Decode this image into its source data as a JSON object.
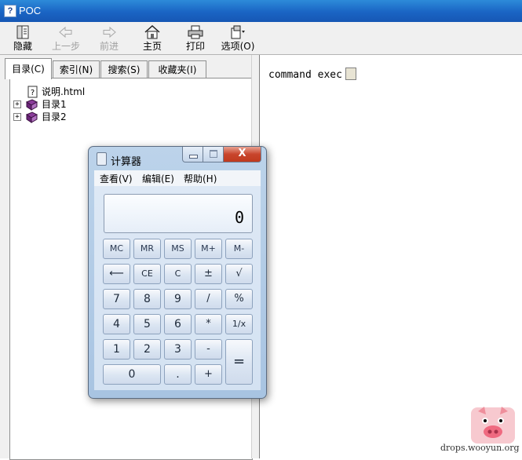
{
  "help_window": {
    "title": "POC",
    "title_icon": "?",
    "toolbar": [
      {
        "label": "隐藏",
        "icon": "hide-icon",
        "enabled": true
      },
      {
        "label": "上一步",
        "icon": "back-arrow-icon",
        "enabled": false
      },
      {
        "label": "前进",
        "icon": "forward-arrow-icon",
        "enabled": false
      },
      {
        "label": "主页",
        "icon": "home-icon",
        "enabled": true
      },
      {
        "label": "打印",
        "icon": "printer-icon",
        "enabled": true
      },
      {
        "label": "选项(O)",
        "icon": "options-icon",
        "enabled": true
      }
    ],
    "tabs": [
      {
        "label": "目录(C)",
        "active": true
      },
      {
        "label": "索引(N)",
        "active": false
      },
      {
        "label": "搜索(S)",
        "active": false
      },
      {
        "label": "收藏夹(I)",
        "active": false
      }
    ],
    "tree": [
      {
        "label": "说明.html",
        "icon": "help-page-icon",
        "expandable": false
      },
      {
        "label": "目录1",
        "icon": "book-icon",
        "expandable": true
      },
      {
        "label": "目录2",
        "icon": "book-icon",
        "expandable": true
      }
    ],
    "content_text": "command exec"
  },
  "calculator": {
    "title": "计算器",
    "close_glyph": "X",
    "menu": [
      "查看(V)",
      "编辑(E)",
      "帮助(H)"
    ],
    "display": "0",
    "keys": {
      "mc": "MC",
      "mr": "MR",
      "ms": "MS",
      "mplus": "M+",
      "mminus": "M-",
      "back": "⟵",
      "ce": "CE",
      "c": "C",
      "plusminus": "±",
      "sqrt": "√",
      "k7": "7",
      "k8": "8",
      "k9": "9",
      "div": "/",
      "pct": "%",
      "k4": "4",
      "k5": "5",
      "k6": "6",
      "mul": "*",
      "recip": "1/x",
      "k1": "1",
      "k2": "2",
      "k3": "3",
      "sub": "-",
      "eq": "=",
      "k0": "0",
      "dot": ".",
      "add": "+"
    }
  },
  "watermark": {
    "text": "drops.wooyun.org",
    "logo": "pig-logo"
  }
}
